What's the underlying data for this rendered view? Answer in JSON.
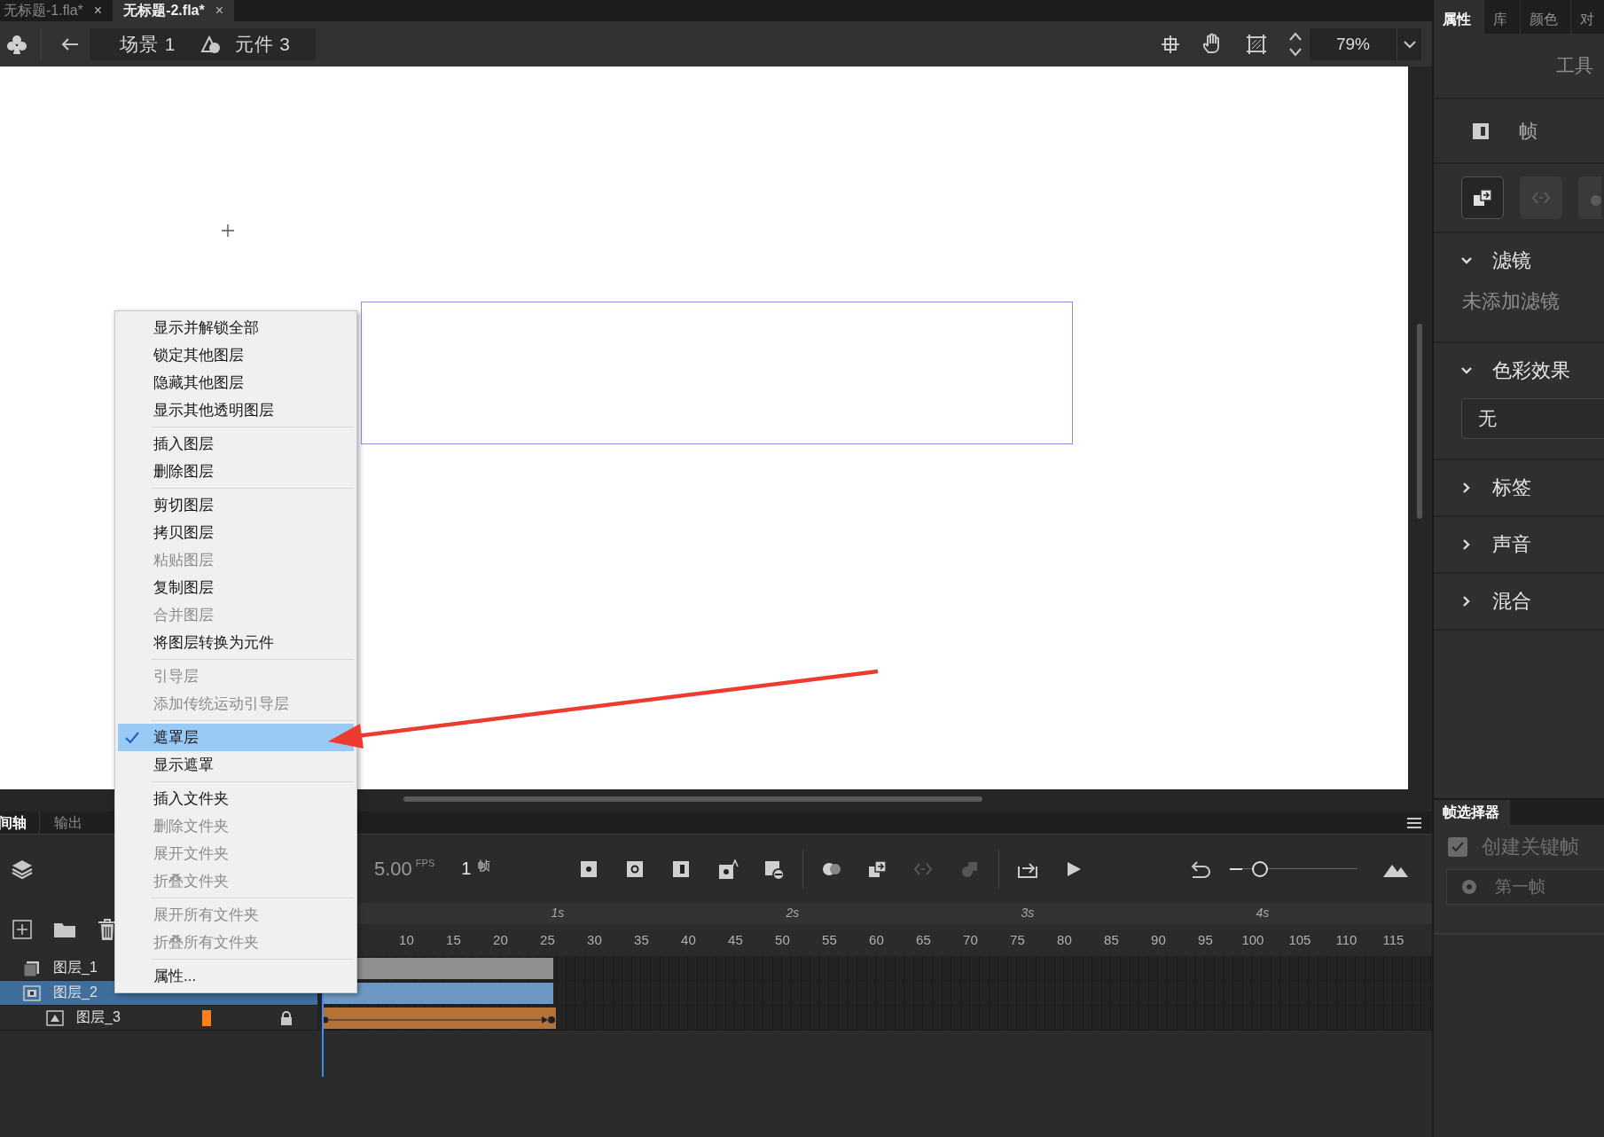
{
  "document_tabs": [
    {
      "label": "无标题-1.fla*",
      "close": "×",
      "selected": false
    },
    {
      "label": "无标题-2.fla*",
      "close": "×",
      "selected": true
    }
  ],
  "breadcrumb": [
    {
      "kind": "scene",
      "label": "场景 1"
    },
    {
      "kind": "symbol",
      "label": "元件 3"
    }
  ],
  "zoom": {
    "value": "79%"
  },
  "context_menu": {
    "groups": [
      [
        {
          "label": "显示并解锁全部",
          "disabled": false,
          "checked": false,
          "selected": false
        },
        {
          "label": "锁定其他图层",
          "disabled": false,
          "checked": false,
          "selected": false
        },
        {
          "label": "隐藏其他图层",
          "disabled": false,
          "checked": false,
          "selected": false
        },
        {
          "label": "显示其他透明图层",
          "disabled": false,
          "checked": false,
          "selected": false
        }
      ],
      [
        {
          "label": "插入图层",
          "disabled": false,
          "checked": false,
          "selected": false
        },
        {
          "label": "删除图层",
          "disabled": false,
          "checked": false,
          "selected": false
        }
      ],
      [
        {
          "label": "剪切图层",
          "disabled": false,
          "checked": false,
          "selected": false
        },
        {
          "label": "拷贝图层",
          "disabled": false,
          "checked": false,
          "selected": false
        },
        {
          "label": "粘贴图层",
          "disabled": true,
          "checked": false,
          "selected": false
        },
        {
          "label": "复制图层",
          "disabled": false,
          "checked": false,
          "selected": false
        },
        {
          "label": "合并图层",
          "disabled": true,
          "checked": false,
          "selected": false
        },
        {
          "label": "将图层转换为元件",
          "disabled": false,
          "checked": false,
          "selected": false
        }
      ],
      [
        {
          "label": "引导层",
          "disabled": true,
          "checked": false,
          "selected": false
        },
        {
          "label": "添加传统运动引导层",
          "disabled": true,
          "checked": false,
          "selected": false
        }
      ],
      [
        {
          "label": "遮罩层",
          "disabled": false,
          "checked": true,
          "selected": true
        },
        {
          "label": "显示遮罩",
          "disabled": false,
          "checked": false,
          "selected": false
        }
      ],
      [
        {
          "label": "插入文件夹",
          "disabled": false,
          "checked": false,
          "selected": false
        },
        {
          "label": "删除文件夹",
          "disabled": true,
          "checked": false,
          "selected": false
        },
        {
          "label": "展开文件夹",
          "disabled": true,
          "checked": false,
          "selected": false
        },
        {
          "label": "折叠文件夹",
          "disabled": true,
          "checked": false,
          "selected": false
        }
      ],
      [
        {
          "label": "展开所有文件夹",
          "disabled": true,
          "checked": false,
          "selected": false
        },
        {
          "label": "折叠所有文件夹",
          "disabled": true,
          "checked": false,
          "selected": false
        }
      ],
      [
        {
          "label": "属性...",
          "disabled": false,
          "checked": false,
          "selected": false
        }
      ]
    ]
  },
  "timeline": {
    "tabs": [
      {
        "label": "间轴",
        "selected": true
      },
      {
        "label": "输出",
        "selected": false
      }
    ],
    "fps": "5.00",
    "fps_unit": "FPS",
    "frame": "1",
    "frame_unit": "帧",
    "seconds": [
      "1s",
      "2s",
      "3s",
      "4s"
    ],
    "zoom_slider": {
      "level": 0.1
    },
    "frame_numbers": [
      "10",
      "15",
      "20",
      "25",
      "30",
      "35",
      "40",
      "45",
      "50",
      "55",
      "60",
      "65",
      "70",
      "75",
      "80",
      "85",
      "90",
      "95",
      "100",
      "105",
      "110",
      "115"
    ],
    "layers": [
      {
        "name": "图层_1",
        "kind": "normal",
        "selected": false,
        "locked": false
      },
      {
        "name": "图层_2",
        "kind": "mask",
        "selected": true,
        "locked": false,
        "children": [
          {
            "name": "图层_3",
            "kind": "masked",
            "selected": false,
            "locked": true,
            "color": "#ff7f1c"
          }
        ]
      }
    ]
  },
  "properties": {
    "tabs": [
      {
        "label": "属性",
        "selected": true
      },
      {
        "label": "库",
        "selected": false
      },
      {
        "label": "颜色",
        "selected": false
      },
      {
        "label": "对",
        "selected": false
      }
    ],
    "header": "工具",
    "frame_label": "帧",
    "sections": [
      {
        "title": "滤镜",
        "expanded": true,
        "kind": "text",
        "content": "未添加滤镜"
      },
      {
        "title": "色彩效果",
        "expanded": true,
        "kind": "dropdown",
        "content": "无"
      },
      {
        "title": "标签",
        "expanded": false
      },
      {
        "title": "声音",
        "expanded": false
      },
      {
        "title": "混合",
        "expanded": false
      }
    ]
  },
  "frame_picker": {
    "tab": "帧选择器",
    "create_keyframe": {
      "label": "创建关键帧",
      "checked": true
    },
    "first_frame": {
      "label": "第一帧"
    }
  }
}
